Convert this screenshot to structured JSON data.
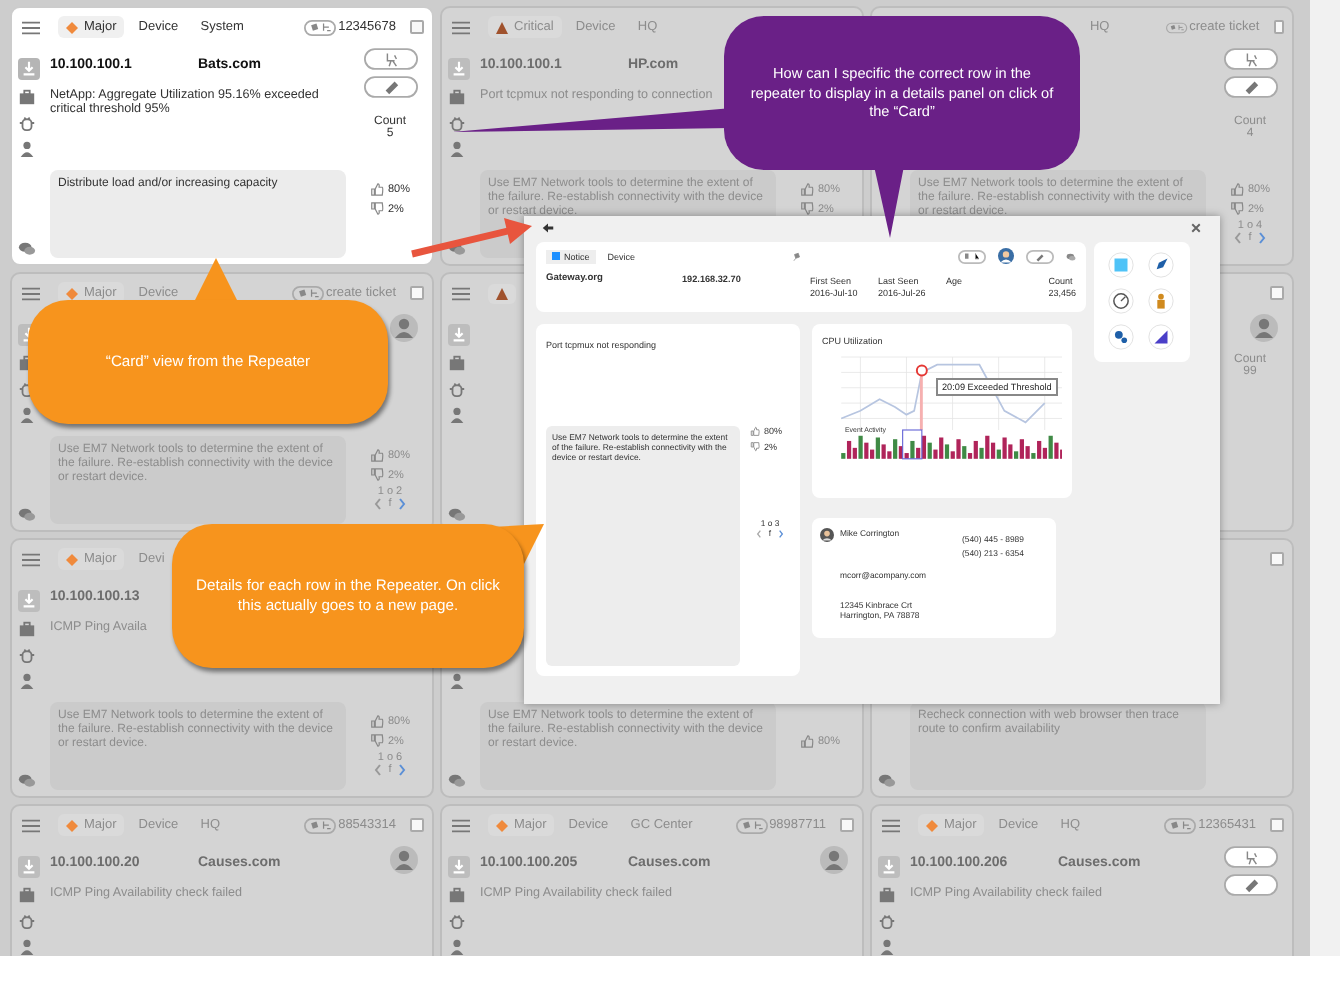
{
  "cards": [
    {
      "highlighted": true,
      "severity": {
        "kind": "major",
        "label": "Major"
      },
      "labels": [
        "Device",
        "System"
      ],
      "ticket": "12345678",
      "ip": "10.100.100.1",
      "host": "Bats.com",
      "message": "NetApp: Aggregate Utilization 95.16% exceeded critical threshold 95%",
      "kind": "buttons",
      "count_label": "Count",
      "count": "5",
      "note": "Distribute load and/or increasing capacity",
      "up": "80%",
      "down": "2%"
    },
    {
      "highlighted": false,
      "severity": {
        "kind": "critical",
        "label": "Critical"
      },
      "labels": [
        "Device",
        "HQ"
      ],
      "ip": "10.100.100.1",
      "host": "HP.com",
      "message": "Port tcpmux not responding to connection",
      "note": "Use EM7 Network tools to determine the extent of the failure. Re-establish connectivity with the device or restart device.",
      "up": "80%",
      "down": "2%"
    },
    {
      "highlighted": false,
      "labels": [
        "HQ"
      ],
      "ticket": "create ticket",
      "kind": "buttons",
      "count_label": "Count",
      "count": "4",
      "note": "Use EM7 Network tools to determine the extent of the failure. Re-establish connectivity with the device or restart device.",
      "up": "80%",
      "down": "2%",
      "pager": [
        "1 o 4",
        "f"
      ]
    },
    {
      "highlighted": false,
      "severity": {
        "kind": "major",
        "label": "Major"
      },
      "labels": [
        "Device"
      ],
      "ticket": "create ticket",
      "kind": "avatar",
      "note": "Use EM7 Network tools to determine the extent of the failure. Re-establish connectivity with the device or restart device.",
      "up": "80%",
      "down": "2%",
      "pager": [
        "1 o 2",
        "f"
      ]
    },
    {
      "highlighted": false,
      "severity": {
        "kind": "critical"
      }
    },
    {
      "highlighted": false,
      "kind": "avatar",
      "count_label": "Count",
      "count": "99"
    },
    {
      "highlighted": false,
      "severity": {
        "kind": "major",
        "label": "Major"
      },
      "labels": [
        "Devi"
      ],
      "ip": "10.100.100.13",
      "message": "ICMP Ping Availa",
      "note": "Use EM7 Network tools to determine the extent of the failure. Re-establish connectivity with the device or restart device.",
      "up": "80%",
      "down": "2%",
      "pager": [
        "1 o 6",
        "f"
      ]
    },
    {
      "highlighted": false,
      "note": "Use EM7 Network tools to determine the extent of the failure. Re-establish connectivity with the device or restart device.",
      "up": "80%"
    },
    {
      "highlighted": false,
      "note": "Recheck connection with web browser then trace route to confirm availability"
    },
    {
      "highlighted": false,
      "severity": {
        "kind": "major",
        "label": "Major"
      },
      "labels": [
        "Device",
        "HQ"
      ],
      "ticket": "88543314",
      "ip": "10.100.100.20",
      "host": "Causes.com",
      "message": "ICMP Ping Availability check failed",
      "kind": "avatar"
    },
    {
      "highlighted": false,
      "severity": {
        "kind": "major",
        "label": "Major"
      },
      "labels": [
        "Device",
        "GC Center"
      ],
      "ticket": "98987711",
      "ip": "10.100.100.205",
      "host": "Causes.com",
      "message": "ICMP Ping Availability check failed",
      "kind": "avatar"
    },
    {
      "highlighted": false,
      "severity": {
        "kind": "major",
        "label": "Major"
      },
      "labels": [
        "Device",
        "HQ"
      ],
      "ticket": "12365431",
      "ip": "10.100.100.206",
      "host": "Causes.com",
      "message": "ICMP Ping Availability check failed",
      "kind": "buttons"
    }
  ],
  "detail": {
    "summary": {
      "severity": {
        "kind": "notice",
        "label": "Notice"
      },
      "label": "Device",
      "host": "Gateway.org",
      "ip": "192.168.32.70",
      "fields": [
        {
          "label": "First Seen",
          "value": "2016-Jul-10"
        },
        {
          "label": "Last Seen",
          "value": "2016-Jul-26"
        },
        {
          "label": "Age"
        },
        {
          "label": "Count",
          "value": "23,456"
        }
      ]
    },
    "message": "Port tcpmux not responding",
    "note": "Use EM7 Network tools to determine the extent of the failure. Re-establish connectivity with the device or restart device.",
    "up": "80%",
    "down": "2%",
    "pager": [
      "1 o 3",
      "f"
    ],
    "chart": {
      "title": "CPU Utilization",
      "tooltip": "20:09 Exceeded Threshold",
      "activity_label": "Event Activity"
    },
    "contact": {
      "name": "Mike Corrington",
      "phones": [
        "(540) 445 - 8989",
        "(540) 213 - 6354"
      ],
      "email": "mcorr@acompany.com",
      "address": [
        "12345 Kinbrace Crt",
        "Harrington, PA 78878"
      ]
    }
  },
  "callouts": [
    {
      "kind": "purple",
      "text": "How can I specific the correct row in the repeater to display in a details panel on click of the “Card”"
    },
    {
      "kind": "orange-up",
      "text": "“Card” view from the Repeater"
    },
    {
      "kind": "orange-right",
      "text": "Details for each row in the Repeater. On click this actually goes to a new page."
    }
  ]
}
